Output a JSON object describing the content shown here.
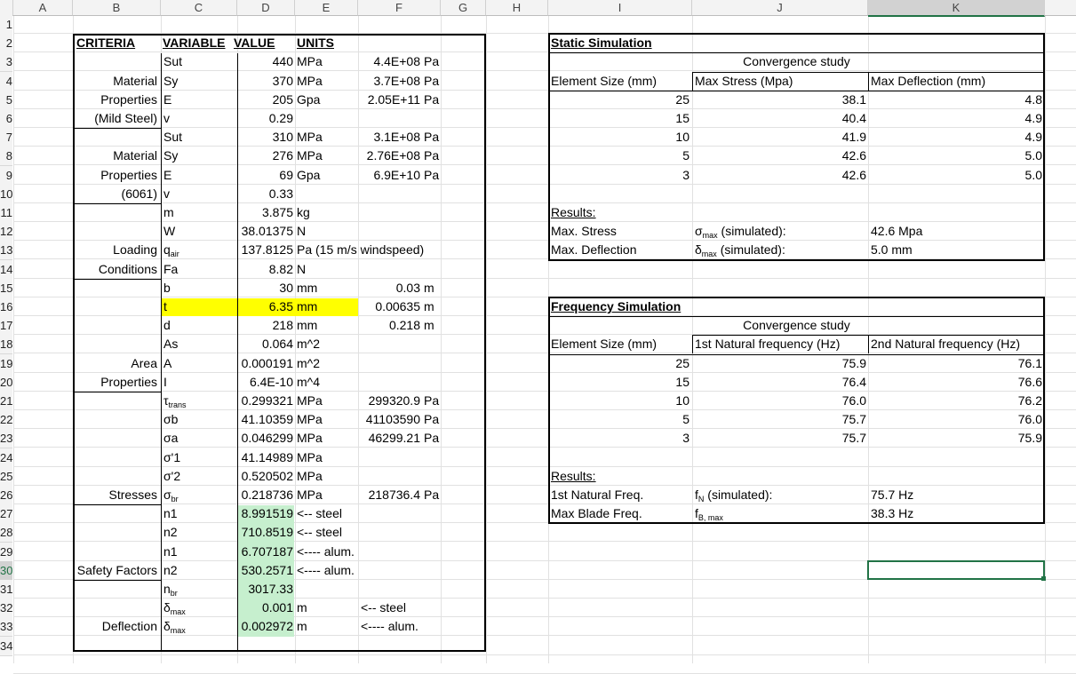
{
  "columns": [
    "A",
    "B",
    "C",
    "D",
    "E",
    "F",
    "G",
    "H",
    "I",
    "J",
    "K"
  ],
  "rows": [
    "1",
    "2",
    "3",
    "4",
    "5",
    "6",
    "7",
    "8",
    "9",
    "10",
    "11",
    "12",
    "13",
    "14",
    "15",
    "16",
    "17",
    "18",
    "19",
    "20",
    "21",
    "22",
    "23",
    "24",
    "25",
    "26",
    "27",
    "28",
    "29",
    "30",
    "31",
    "32",
    "33",
    "34"
  ],
  "colors": {
    "highlight": "#ffff00",
    "green_fill": "#c6efce",
    "selection": "#217346"
  },
  "left_table": {
    "headers": {
      "criteria": "CRITERIA",
      "variable": "VARIABLE",
      "value": "VALUE",
      "units": "UNITS"
    },
    "groups": {
      "mild_steel_1": "Material",
      "mild_steel_2": "Properties",
      "mild_steel_3": "(Mild Steel)",
      "al_1": "Material",
      "al_2": "Properties",
      "al_3": "(6061)",
      "loading_1": "Loading",
      "loading_2": "Conditions",
      "area_1": "Area",
      "area_2": "Properties",
      "stresses": "Stresses",
      "safety": "Safety Factors",
      "deflection": "Deflection"
    },
    "rows": [
      {
        "var": "Sut",
        "sub": "",
        "value": "440",
        "unit": "MPa",
        "f": "4.4E+08",
        "g": "Pa"
      },
      {
        "var": "Sy",
        "sub": "",
        "value": "370",
        "unit": "MPa",
        "f": "3.7E+08",
        "g": "Pa"
      },
      {
        "var": "E",
        "sub": "",
        "value": "205",
        "unit": "Gpa",
        "f": "2.05E+11",
        "g": "Pa"
      },
      {
        "var": "v",
        "sub": "",
        "value": "0.29",
        "unit": "",
        "f": "",
        "g": ""
      },
      {
        "var": "Sut",
        "sub": "",
        "value": "310",
        "unit": "MPa",
        "f": "3.1E+08",
        "g": "Pa"
      },
      {
        "var": "Sy",
        "sub": "",
        "value": "276",
        "unit": "MPa",
        "f": "2.76E+08",
        "g": "Pa"
      },
      {
        "var": "E",
        "sub": "",
        "value": "69",
        "unit": "Gpa",
        "f": "6.9E+10",
        "g": "Pa"
      },
      {
        "var": "v",
        "sub": "",
        "value": "0.33",
        "unit": "",
        "f": "",
        "g": ""
      },
      {
        "var": "m",
        "sub": "",
        "value": "3.875",
        "unit": "kg",
        "f": "",
        "g": ""
      },
      {
        "var": "W",
        "sub": "",
        "value": "38.01375",
        "unit": "N",
        "f": "",
        "g": ""
      },
      {
        "var": "q",
        "sub": "air",
        "value": "137.8125",
        "unit": "Pa (15 m/s windspeed)",
        "f": "",
        "g": ""
      },
      {
        "var": "Fa",
        "sub": "",
        "value": "8.82",
        "unit": "N",
        "f": "",
        "g": ""
      },
      {
        "var": "b",
        "sub": "",
        "value": "30",
        "unit": "mm",
        "f": "0.03",
        "g": "m"
      },
      {
        "var": "t",
        "sub": "",
        "value": "6.35",
        "unit": "mm",
        "f": "0.00635",
        "g": "m"
      },
      {
        "var": "d",
        "sub": "",
        "value": "218",
        "unit": "mm",
        "f": "0.218",
        "g": "m"
      },
      {
        "var": "As",
        "sub": "",
        "value": "0.064",
        "unit": "m^2",
        "f": "",
        "g": ""
      },
      {
        "var": "A",
        "sub": "",
        "value": "0.000191",
        "unit": "m^2",
        "f": "",
        "g": ""
      },
      {
        "var": "I",
        "sub": "",
        "value": "6.4E-10",
        "unit": "m^4",
        "f": "",
        "g": ""
      },
      {
        "var": "τ",
        "sub": "trans",
        "value": "0.299321",
        "unit": "MPa",
        "f": "299320.9",
        "g": "Pa"
      },
      {
        "var": "σb",
        "sub": "",
        "value": "41.10359",
        "unit": "MPa",
        "f": "41103590",
        "g": "Pa"
      },
      {
        "var": "σa",
        "sub": "",
        "value": "0.046299",
        "unit": "MPa",
        "f": "46299.21",
        "g": "Pa"
      },
      {
        "var": "σ'1",
        "sub": "",
        "value": "41.14989",
        "unit": "MPa",
        "f": "",
        "g": ""
      },
      {
        "var": "σ'2",
        "sub": "",
        "value": "0.520502",
        "unit": "MPa",
        "f": "",
        "g": ""
      },
      {
        "var": "σ",
        "sub": "br",
        "value": "0.218736",
        "unit": "MPa",
        "f": "218736.4",
        "g": "Pa"
      },
      {
        "var": "n1",
        "sub": "",
        "value": "8.991519",
        "unit": "<-- steel",
        "f": "",
        "g": ""
      },
      {
        "var": "n2",
        "sub": "",
        "value": "710.8519",
        "unit": "<-- steel",
        "f": "",
        "g": ""
      },
      {
        "var": "n1",
        "sub": "",
        "value": "6.707187",
        "unit": "<---- alum.",
        "f": "",
        "g": ""
      },
      {
        "var": "n2",
        "sub": "",
        "value": "530.2571",
        "unit": "<---- alum.",
        "f": "",
        "g": ""
      },
      {
        "var": "n",
        "sub": "br",
        "value": "3017.33",
        "unit": "",
        "f": "",
        "g": ""
      },
      {
        "var": "δ",
        "sub": "max",
        "value": "0.001",
        "unit": "m",
        "f": "<-- steel",
        "g": ""
      },
      {
        "var": "δ",
        "sub": "max",
        "value": "0.002972",
        "unit": "m",
        "f": "<---- alum.",
        "g": ""
      }
    ]
  },
  "static_sim": {
    "title": "Static Simulation",
    "study": "Convergence study",
    "headers": [
      "Element Size (mm)",
      "Max Stress (Mpa)",
      "Max Deflection (mm)"
    ],
    "rows": [
      [
        "25",
        "38.1",
        "4.8"
      ],
      [
        "15",
        "40.4",
        "4.9"
      ],
      [
        "10",
        "41.9",
        "4.9"
      ],
      [
        "5",
        "42.6",
        "5.0"
      ],
      [
        "3",
        "42.6",
        "5.0"
      ]
    ],
    "results_label": "Results:",
    "result1": {
      "label": "Max. Stress",
      "sym": "σ",
      "sub": "max",
      "desc": " (simulated):",
      "value": "42.6 Mpa"
    },
    "result2": {
      "label": "Max. Deflection",
      "sym": "δ",
      "sub": "max",
      "desc": " (simulated):",
      "value": "5.0 mm"
    }
  },
  "freq_sim": {
    "title": "Frequency Simulation",
    "study": "Convergence study",
    "headers": [
      "Element Size (mm)",
      "1st Natural frequency (Hz)",
      "2nd Natural frequency (Hz)"
    ],
    "rows": [
      [
        "25",
        "75.9",
        "76.1"
      ],
      [
        "15",
        "76.4",
        "76.6"
      ],
      [
        "10",
        "76.0",
        "76.2"
      ],
      [
        "5",
        "75.7",
        "76.0"
      ],
      [
        "3",
        "75.7",
        "75.9"
      ]
    ],
    "results_label": "Results:",
    "result1": {
      "label": "1st Natural Freq.",
      "sym": "f",
      "sub": "N",
      "desc": " (simulated):",
      "value": "75.7 Hz"
    },
    "result2": {
      "label": "Max Blade Freq.",
      "sym": "f",
      "sub": "B, max",
      "desc": "",
      "value": "38.3 Hz"
    }
  }
}
